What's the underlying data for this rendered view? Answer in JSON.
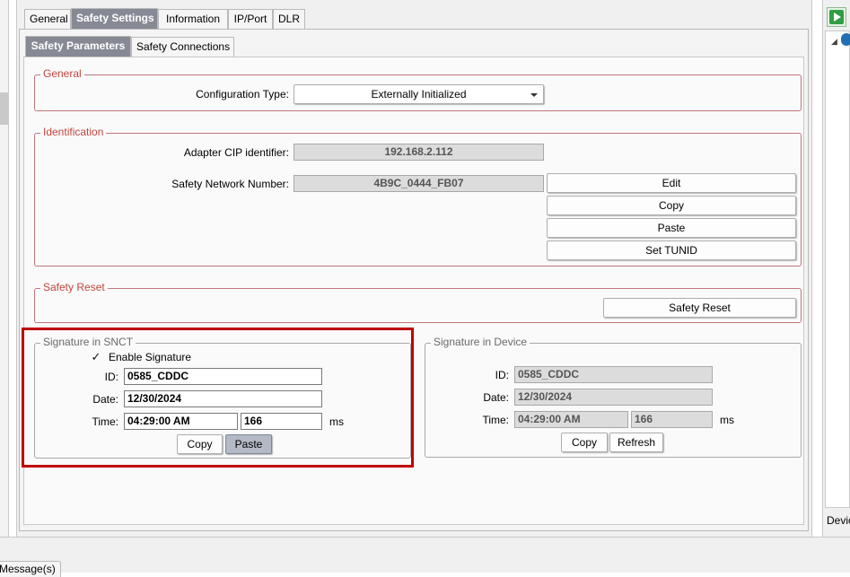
{
  "tabs_top": [
    "General",
    "Safety Settings",
    "Information",
    "IP/Port",
    "DLR"
  ],
  "tabs_sub": [
    "Safety Parameters",
    "Safety Connections"
  ],
  "general_group": {
    "legend": "General",
    "config_type_label": "Configuration Type:",
    "config_type_value": "Externally Initialized"
  },
  "identification": {
    "legend": "Identification",
    "adapter_label": "Adapter CIP identifier:",
    "adapter_value": "192.168.2.112",
    "snn_label": "Safety Network Number:",
    "snn_value": "4B9C_0444_FB07",
    "buttons": [
      "Edit",
      "Copy",
      "Paste",
      "Set TUNID"
    ]
  },
  "safety_reset": {
    "legend": "Safety Reset",
    "button": "Safety Reset"
  },
  "signature_snct": {
    "legend": "Signature in SNCT",
    "enable_label": "Enable Signature",
    "enable_checked": true,
    "id_label": "ID:",
    "id_value": "0585_CDDC",
    "date_label": "Date:",
    "date_value": "12/30/2024",
    "time_label": "Time:",
    "time_value": "04:29:00 AM",
    "ms_value": "166",
    "ms_label": "ms",
    "copy_button": "Copy",
    "paste_button": "Paste"
  },
  "signature_device": {
    "legend": "Signature in Device",
    "id_label": "ID:",
    "id_value": "0585_CDDC",
    "date_label": "Date:",
    "date_value": "12/30/2024",
    "time_label": "Time:",
    "time_value": "04:29:00 AM",
    "ms_value": "166",
    "ms_label": "ms",
    "copy_button": "Copy",
    "refresh_button": "Refresh"
  },
  "right_panel": {
    "bottom_label": "Devic"
  },
  "bottom": {
    "messages_tab": "Message(s)"
  },
  "colors": {
    "active_tab": "#878a95",
    "group_border": "#c0767d",
    "group_legend": "#c0463e",
    "highlight": "#c00000"
  }
}
